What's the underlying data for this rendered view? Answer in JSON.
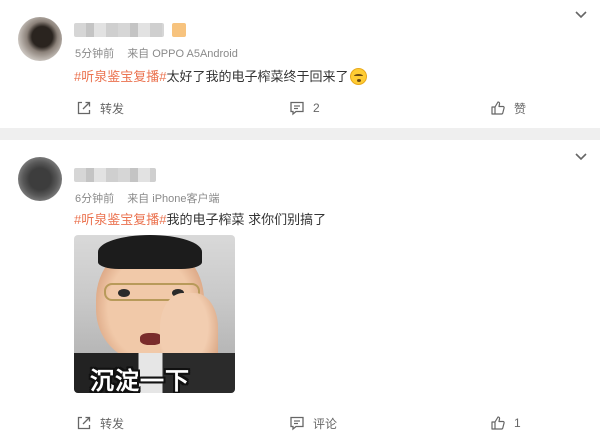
{
  "posts": [
    {
      "time": "5分钟前",
      "source_prefix": "来自",
      "source": "OPPO A5Android",
      "hashtag": "#听泉鉴宝复播#",
      "text": "太好了我的电子榨菜终于回来了",
      "emoji": "astonished-face",
      "actions": {
        "repost": "转发",
        "comment": "2",
        "like": "赞"
      }
    },
    {
      "time": "6分钟前",
      "source_prefix": "来自",
      "source": "iPhone客户端",
      "hashtag": "#听泉鉴宝复播#",
      "text": "我的电子榨菜 求你们别搞了",
      "image_caption": "沉淀一下",
      "actions": {
        "repost": "转发",
        "comment": "评论",
        "like": "1"
      }
    }
  ],
  "icons": {
    "repost": "repost-icon",
    "comment": "comment-icon",
    "like": "thumbs-up-icon",
    "menu": "chevron-down-icon"
  },
  "colors": {
    "hashtag": "#eb7350",
    "meta": "#8a8a8a",
    "background": "#efefef",
    "card": "#ffffff"
  }
}
